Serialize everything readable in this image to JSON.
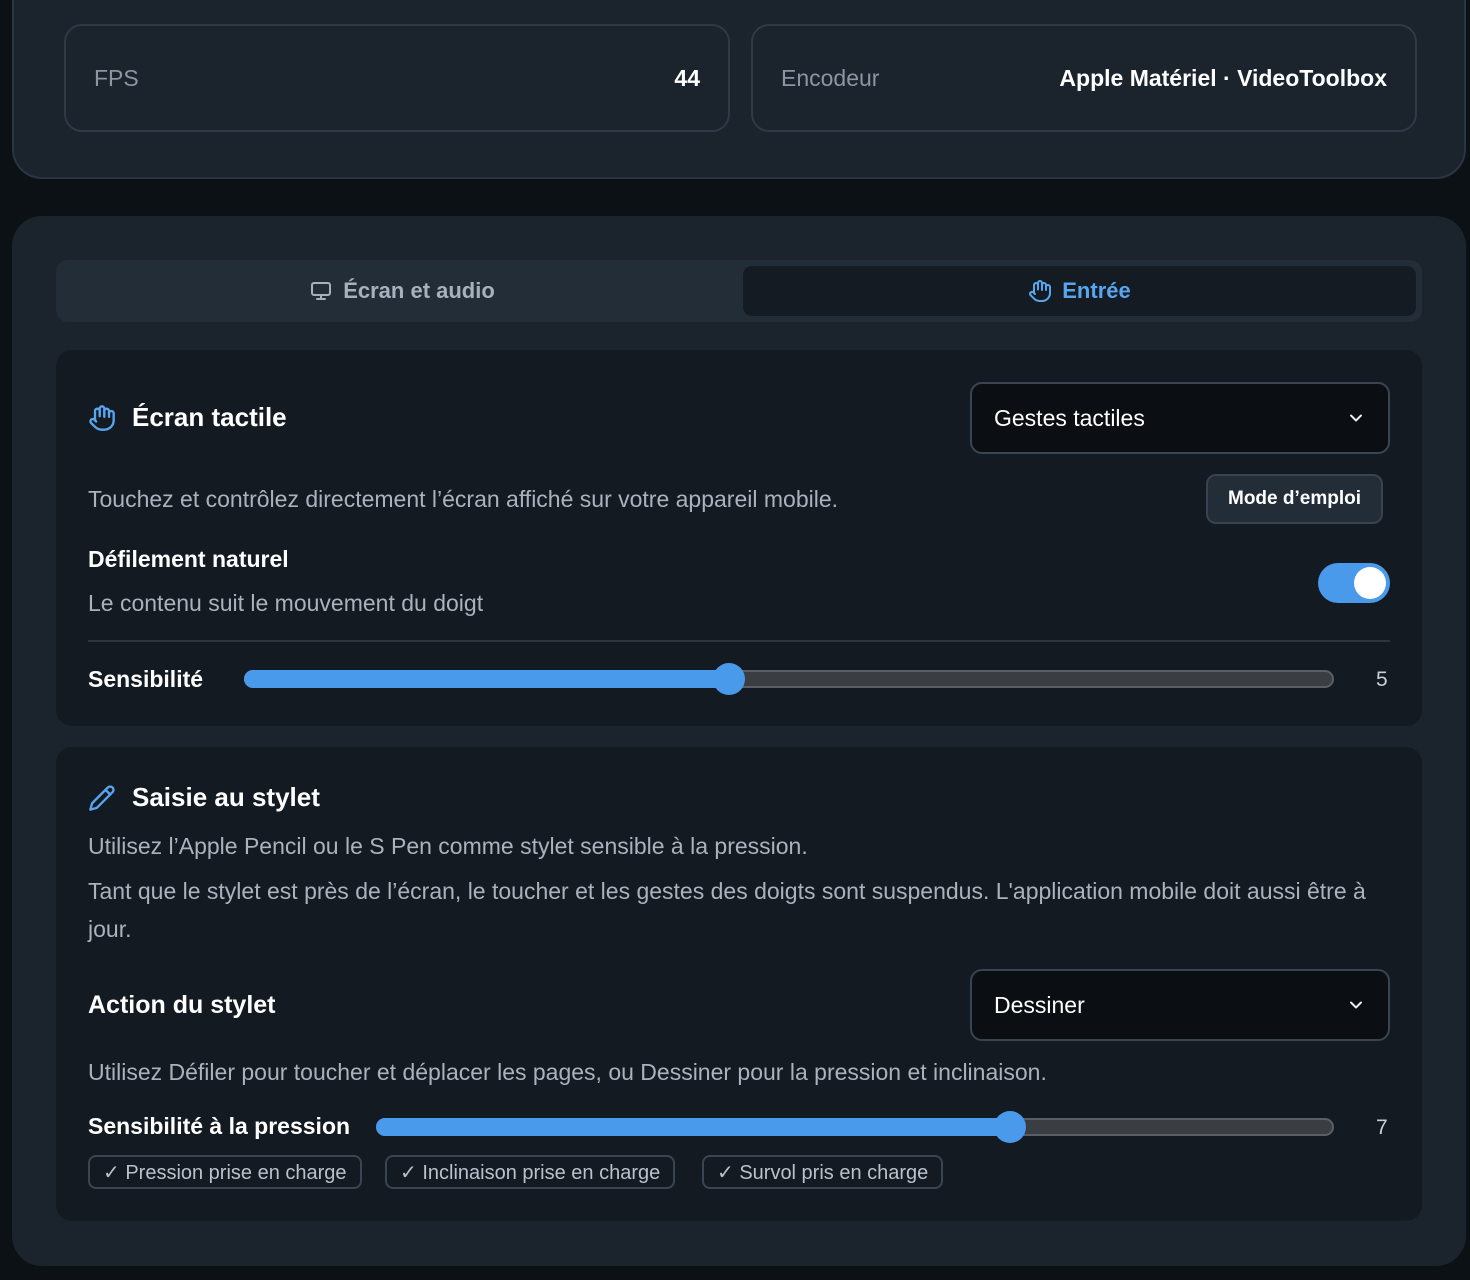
{
  "stats": {
    "fps": {
      "label": "FPS",
      "value": "44"
    },
    "encoder": {
      "label": "Encodeur",
      "value": "Apple Matériel · VideoToolbox"
    }
  },
  "tabs": [
    {
      "label": "Écran et audio",
      "icon": "monitor-icon",
      "active": false
    },
    {
      "label": "Entrée",
      "icon": "hand-icon",
      "active": true
    }
  ],
  "touch": {
    "title": "Écran tactile",
    "icon": "hand-icon",
    "mode_select": {
      "value": "Gestes tactiles"
    },
    "description": "Touchez et contrôlez directement l’écran affiché sur votre appareil mobile.",
    "help_button": "Mode d’emploi",
    "natural_scroll": {
      "label": "Défilement naturel",
      "description": "Le contenu suit le mouvement du doigt",
      "enabled": true
    },
    "sensitivity": {
      "label": "Sensibilité",
      "value": "5",
      "fraction": 0.445
    }
  },
  "stylus": {
    "title": "Saisie au stylet",
    "icon": "pencil-icon",
    "description1": "Utilisez l’Apple Pencil ou le S Pen comme stylet sensible à la pression.",
    "description2": "Tant que le stylet est près de l’écran, le toucher et les gestes des doigts sont suspendus. L'application mobile doit aussi être à jour.",
    "action": {
      "label": "Action du stylet",
      "select_value": "Dessiner",
      "description": "Utilisez Défiler pour toucher et déplacer les pages, ou Dessiner pour la pression et inclinaison."
    },
    "pressure": {
      "label": "Sensibilité à la pression",
      "value": "7",
      "fraction": 0.662
    },
    "chips": [
      "✓ Pression prise en charge",
      "✓ Inclinaison prise en charge",
      "✓ Survol pris en charge"
    ]
  },
  "colors": {
    "accent": "#4a9aeb",
    "background": "#0c1116",
    "card": "#1b232d",
    "section": "#141a21"
  }
}
